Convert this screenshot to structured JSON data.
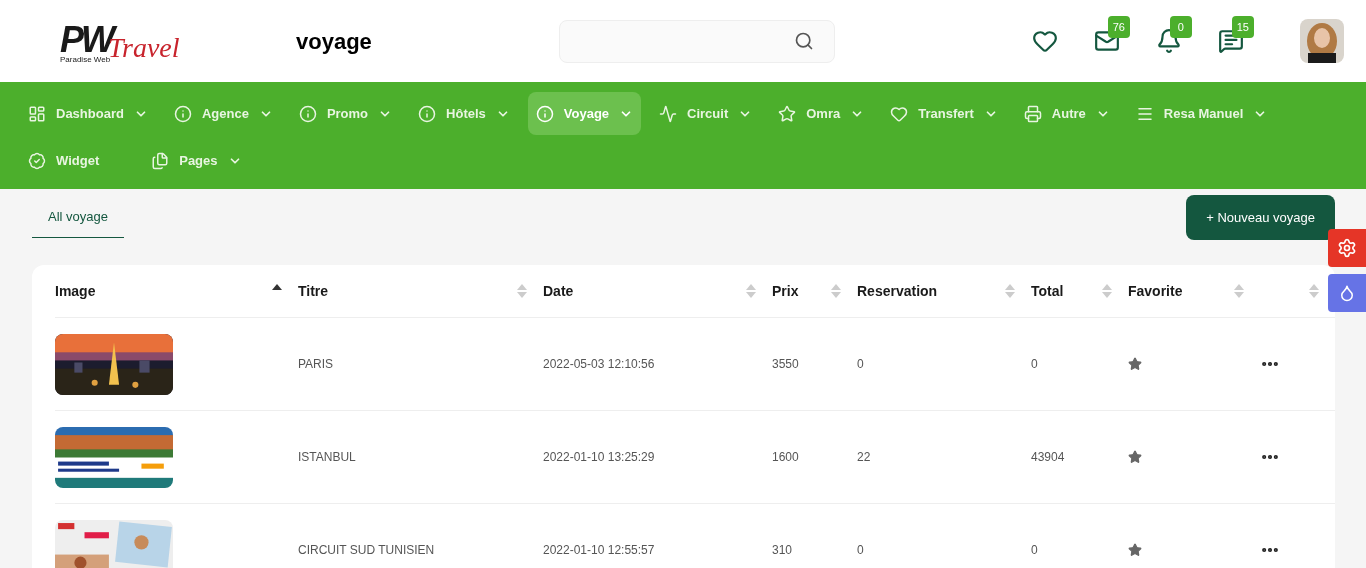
{
  "header": {
    "logo": {
      "mark": "PW",
      "tagline": "Paradise Web",
      "script": "Travel"
    },
    "page_title": "voyage",
    "badges": [
      {
        "count": "76"
      },
      {
        "count": "0"
      },
      {
        "count": "15"
      }
    ]
  },
  "nav": [
    {
      "label": "Dashboard",
      "selected": false,
      "menu": true
    },
    {
      "label": "Agence",
      "selected": false,
      "menu": true
    },
    {
      "label": "Promo",
      "selected": false,
      "menu": true
    },
    {
      "label": "Hôtels",
      "selected": false,
      "menu": true
    },
    {
      "label": "Voyage",
      "selected": true,
      "menu": true
    },
    {
      "label": "Circuit",
      "selected": false,
      "menu": true
    },
    {
      "label": "Omra",
      "selected": false,
      "menu": true
    },
    {
      "label": "Transfert",
      "selected": false,
      "menu": true
    },
    {
      "label": "Autre",
      "selected": false,
      "menu": true
    },
    {
      "label": "Resa Manuel",
      "selected": false,
      "menu": true
    },
    {
      "label": "Widget",
      "selected": false,
      "menu": false
    },
    {
      "label": "Pages",
      "selected": false,
      "menu": true
    }
  ],
  "tabs": [
    {
      "label": "All voyage",
      "selected": true
    }
  ],
  "new_button": "+ Nouveau voyage",
  "table": {
    "columns": [
      {
        "label": "Image",
        "sorted": true
      },
      {
        "label": "Titre",
        "sorted": false
      },
      {
        "label": "Date",
        "sorted": false
      },
      {
        "label": "Prix",
        "sorted": false
      },
      {
        "label": "Reservation",
        "sorted": false
      },
      {
        "label": "Total",
        "sorted": false
      },
      {
        "label": "Favorite",
        "sorted": false
      },
      {
        "sorted": false
      }
    ],
    "rows": [
      {
        "titre": "PARIS",
        "date": "2022-05-03 12:10:56",
        "prix": "3550",
        "reservation": "0",
        "total": "0"
      },
      {
        "titre": "ISTANBUL",
        "date": "2022-01-10 13:25:29",
        "prix": "1600",
        "reservation": "22",
        "total": "43904"
      },
      {
        "titre": "CIRCUIT SUD TUNISIEN",
        "date": "2022-01-10 12:55:57",
        "prix": "310",
        "reservation": "0",
        "total": "0"
      }
    ]
  }
}
